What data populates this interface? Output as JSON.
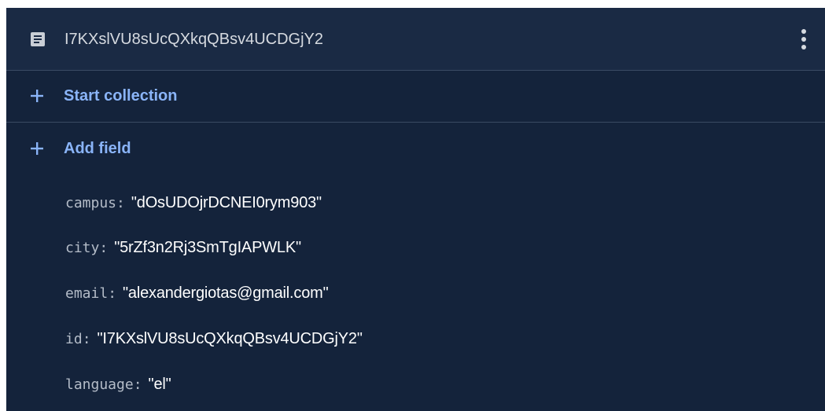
{
  "document": {
    "id": "I7KXslVU8sUcQXkqQBsv4UCDGjY2",
    "doc_icon": "document-icon",
    "more_icon": "more-vert-icon"
  },
  "actions": {
    "start_collection": "Start collection",
    "add_field": "Add field",
    "plus_icon": "plus-icon"
  },
  "fields": [
    {
      "key": "campus",
      "value": "\"dOsUDOjrDCNEI0rym903\""
    },
    {
      "key": "city",
      "value": "\"5rZf3n2Rj3SmTgIAPWLK\""
    },
    {
      "key": "email",
      "value": "\"alexandergiotas@gmail.com\""
    },
    {
      "key": "id",
      "value": "\"I7KXslVU8sUcQXkqQBsv4UCDGjY2\""
    },
    {
      "key": "language",
      "value": "\"el\""
    }
  ],
  "colors": {
    "panel_bg": "#14233b",
    "header_bg": "#1a2a44",
    "accent": "#8ab4f8",
    "divider": "#3a4a63"
  }
}
